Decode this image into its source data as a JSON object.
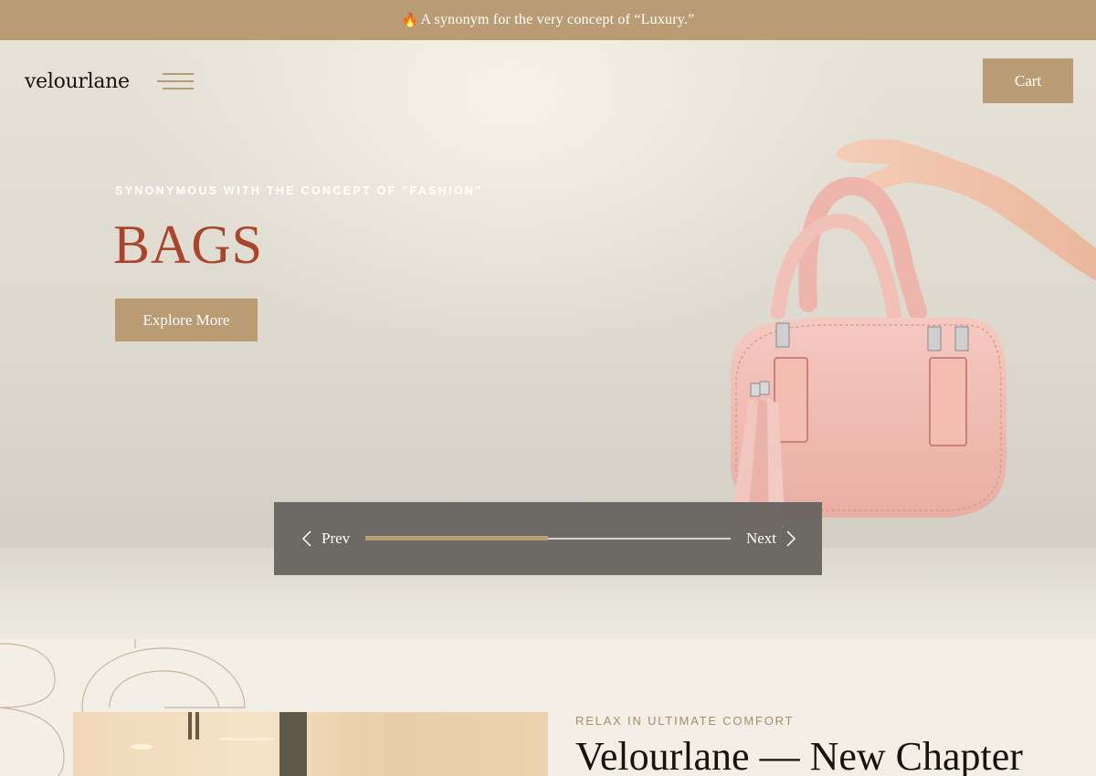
{
  "announcement": {
    "icon": "flame-icon",
    "emoji": "🔥",
    "text": "A synonym for the very concept of “Luxury.”"
  },
  "header": {
    "logo": "velourlane",
    "menu_icon": "hamburger-menu-icon",
    "cart_label": "Cart"
  },
  "hero": {
    "eyebrow": "SYNONYMOUS WITH THE CONCEPT OF \"FASHION\"",
    "title": "BAGS",
    "cta_label": "Explore More",
    "image": "pink-handbag-held-by-hand"
  },
  "slider": {
    "prev_label": "Prev",
    "next_label": "Next",
    "progress": 0.5
  },
  "section2": {
    "eyebrow": "RELAX IN ULTIMATE COMFORT",
    "title": "Velourlane — New Chapter",
    "decorative_letters": "BE"
  },
  "colors": {
    "accent": "#b99c73",
    "title_red": "#a8452a",
    "slider_bg": "#64615c",
    "section_bg": "#f3eee6"
  }
}
